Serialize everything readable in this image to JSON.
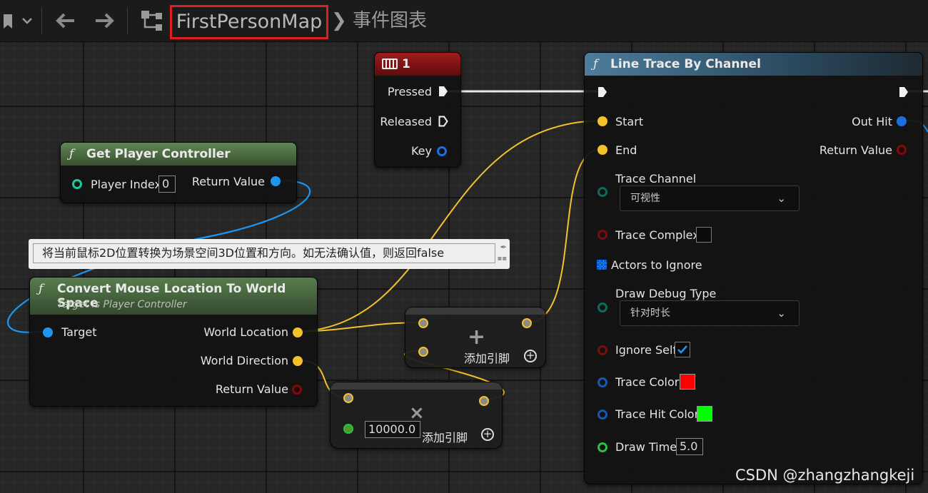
{
  "toolbar": {
    "breadcrumb_main": "FirstPersonMap",
    "breadcrumb_sep": "❯",
    "breadcrumb_sub": "事件图表",
    "icons": [
      "bookmark-icon",
      "chevron-down-icon",
      "back-arrow-icon",
      "forward-arrow-icon",
      "hierarchy-icon"
    ]
  },
  "key_node": {
    "title": "1",
    "pins": {
      "pressed": "Pressed",
      "released": "Released",
      "key": "Key"
    },
    "header_color": "#8c1414"
  },
  "get_pc_node": {
    "title": "Get Player Controller",
    "player_index_label": "Player Index",
    "player_index_value": "0",
    "return_value": "Return Value",
    "header_color": "#4d7043"
  },
  "tooltip": {
    "text": "将当前鼠标2D位置转换为场景空间3D位置和方向。如无法确认值，则返回false"
  },
  "convert_node": {
    "title": "Convert Mouse Location To World Space",
    "subtitle": "Target is Player Controller",
    "target": "Target",
    "world_location": "World Location",
    "world_direction": "World Direction",
    "return_value": "Return Value"
  },
  "add_node": {
    "op": "+",
    "add_pin": "添加引脚"
  },
  "mul_node": {
    "op": "×",
    "value": "10000.0",
    "add_pin": "添加引脚"
  },
  "line_trace": {
    "title": "Line Trace By Channel",
    "start": "Start",
    "end": "End",
    "out_hit": "Out Hit",
    "return_value": "Return Value",
    "trace_channel": "Trace Channel",
    "trace_channel_value": "可视性",
    "trace_complex": "Trace Complex",
    "actors_to_ignore": "Actors to Ignore",
    "draw_debug_type": "Draw Debug Type",
    "draw_debug_value": "针对时长",
    "ignore_self": "Ignore Self",
    "trace_color": "Trace Color",
    "trace_color_value": "#ff0000",
    "trace_hit_color": "Trace Hit Color",
    "trace_hit_color_value": "#00ff00",
    "draw_time": "Draw Time",
    "draw_time_value": "5.0",
    "header_color": "#3e6a86"
  },
  "watermark": "CSDN @zhangzhangkeji"
}
